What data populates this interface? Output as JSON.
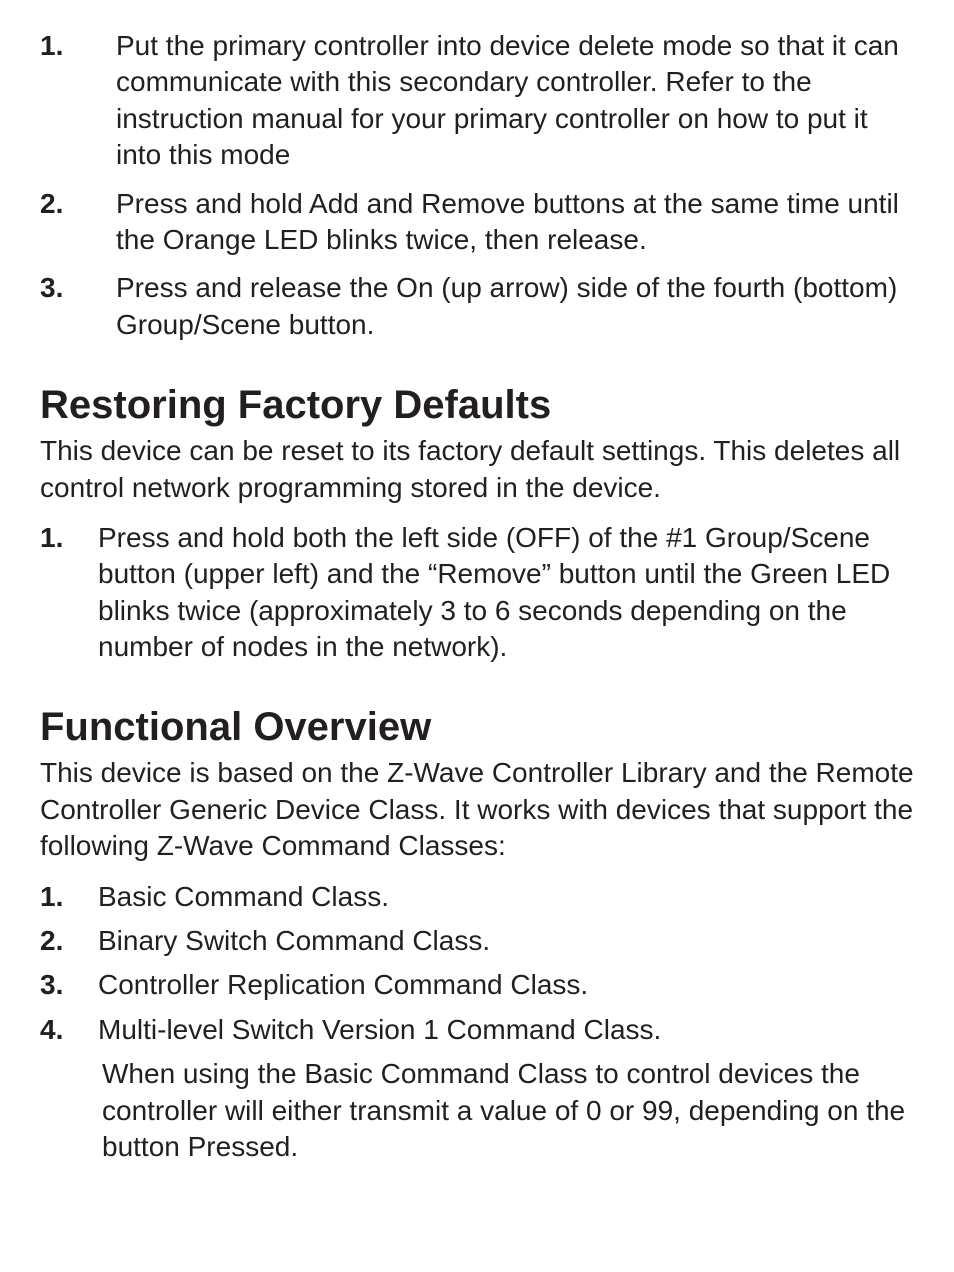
{
  "section1": {
    "items": [
      {
        "num": "1.",
        "text": "Put the primary controller into device delete mode so that it can communicate with this secondary controller.  Refer to the instruction manual for your primary controller on how to put it into this mode"
      },
      {
        "num": "2.",
        "text": "Press and hold Add and Remove buttons at the same time until the Orange LED blinks twice, then release."
      },
      {
        "num": "3.",
        "text": "Press and release the On (up arrow) side of the fourth (bottom) Group/Scene button."
      }
    ]
  },
  "section2": {
    "title": "Restoring Factory Defaults",
    "intro": "This device can be reset to its factory default settings. This deletes all control network programming stored in the device.",
    "items": [
      {
        "num": "1.",
        "text": "Press and hold both the left side (OFF) of the #1 Group/Scene button (upper left) and the “Remove” button until the Green LED blinks twice (approximately 3 to 6 seconds depending on the number of nodes in the network)."
      }
    ]
  },
  "section3": {
    "title": "Functional Overview",
    "intro": "This device is based on the Z-Wave Controller Library and the Remote Controller Generic Device Class.  It works with devices that support the following Z-Wave Command Classes:",
    "items": [
      {
        "num": "1.",
        "text": "Basic Command Class."
      },
      {
        "num": "2.",
        "text": "Binary Switch Command Class."
      },
      {
        "num": "3.",
        "text": "Controller Replication Command Class."
      },
      {
        "num": "4.",
        "text": "Multi-level Switch Version 1 Command Class."
      }
    ],
    "note": "When using the Basic Command Class to control devices the controller will either transmit a value of 0 or 99, depending on the button Pressed."
  }
}
